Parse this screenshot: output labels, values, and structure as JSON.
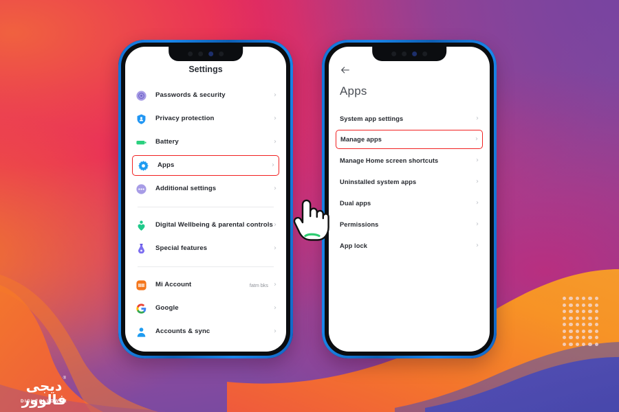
{
  "background": {
    "colors": {
      "pink": "#e8295c",
      "orange": "#f4782a",
      "purple": "#7844a0",
      "magenta": "#c2357f",
      "indigo": "#4a4bb0"
    },
    "dot_grid": {
      "columns": 6,
      "rows": 8,
      "dot_color": "#f4e3ea"
    }
  },
  "watermark": {
    "persian": "دیجی فالوور",
    "english": "DIGI FOLLOWER",
    "registered_mark": "®"
  },
  "phone1": {
    "title": "Settings",
    "highlight_color": "#f11f1f",
    "chevron": "›",
    "groups": [
      {
        "items": [
          {
            "icon": "passwords-security-icon",
            "label": "Passwords & security",
            "value": ""
          },
          {
            "icon": "privacy-protection-icon",
            "label": "Privacy protection",
            "value": ""
          },
          {
            "icon": "battery-icon",
            "label": "Battery",
            "value": ""
          },
          {
            "icon": "apps-gear-icon",
            "label": "Apps",
            "value": "",
            "highlighted": true
          },
          {
            "icon": "additional-settings-icon",
            "label": "Additional settings",
            "value": ""
          }
        ]
      },
      {
        "items": [
          {
            "icon": "digital-wellbeing-icon",
            "label": "Digital Wellbeing & parental controls",
            "value": ""
          },
          {
            "icon": "special-features-icon",
            "label": "Special features",
            "value": ""
          }
        ]
      },
      {
        "items": [
          {
            "icon": "mi-account-icon",
            "label": "Mi Account",
            "value": "fatm bks"
          },
          {
            "icon": "google-icon",
            "label": "Google",
            "value": ""
          },
          {
            "icon": "accounts-sync-icon",
            "label": "Accounts & sync",
            "value": ""
          }
        ]
      }
    ]
  },
  "phone2": {
    "back_icon": "back-arrow-icon",
    "title": "Apps",
    "highlight_color": "#f11f1f",
    "chevron": "›",
    "items": [
      {
        "label": "System app settings"
      },
      {
        "label": "Manage apps",
        "highlighted": true
      },
      {
        "label": "Manage Home screen shortcuts"
      },
      {
        "label": "Uninstalled system apps"
      },
      {
        "label": "Dual apps"
      },
      {
        "label": "Permissions"
      },
      {
        "label": "App lock"
      }
    ]
  },
  "cursors": [
    {
      "name": "hand-pointer-phone1",
      "target": "Apps"
    },
    {
      "name": "hand-pointer-phone2",
      "target": "Manage apps"
    }
  ]
}
